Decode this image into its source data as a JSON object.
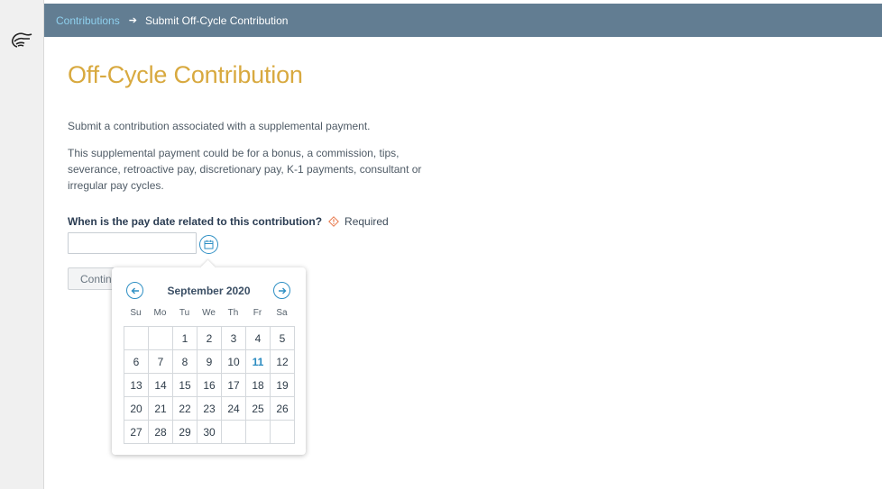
{
  "breadcrumb": {
    "parent": "Contributions",
    "current": "Submit Off-Cycle Contribution"
  },
  "page": {
    "title": "Off-Cycle Contribution",
    "intro": "Submit a contribution associated with a supplemental payment.",
    "description": "This supplemental payment could be for a bonus, a commission, tips, severance, retroactive pay, discretionary pay, K-1 payments, consultant or irregular pay cycles."
  },
  "form": {
    "question": "When is the pay date related to this contribution?",
    "required_label": "Required",
    "date_value": "",
    "continue_label": "Continue"
  },
  "calendar": {
    "month_label": "September 2020",
    "weekdays": [
      "Su",
      "Mo",
      "Tu",
      "We",
      "Th",
      "Fr",
      "Sa"
    ],
    "weeks": [
      [
        "",
        "",
        "1",
        "2",
        "3",
        "4",
        "5"
      ],
      [
        "6",
        "7",
        "8",
        "9",
        "10",
        "11",
        "12"
      ],
      [
        "13",
        "14",
        "15",
        "16",
        "17",
        "18",
        "19"
      ],
      [
        "20",
        "21",
        "22",
        "23",
        "24",
        "25",
        "26"
      ],
      [
        "27",
        "28",
        "29",
        "30",
        "",
        "",
        ""
      ]
    ],
    "highlighted_day": "11"
  },
  "icons": {
    "logo": "hand-pointing-logo-icon",
    "breadcrumb_separator": "arrow-right-icon",
    "required": "warning-diamond-icon",
    "calendar_toggle": "calendar-icon",
    "prev": "arrow-left-icon",
    "next": "arrow-right-icon"
  },
  "colors": {
    "topbar": "#627d92",
    "link": "#8ed0ee",
    "title": "#d8a93f",
    "accent": "#2e8fc4",
    "required": "#e8774a"
  }
}
